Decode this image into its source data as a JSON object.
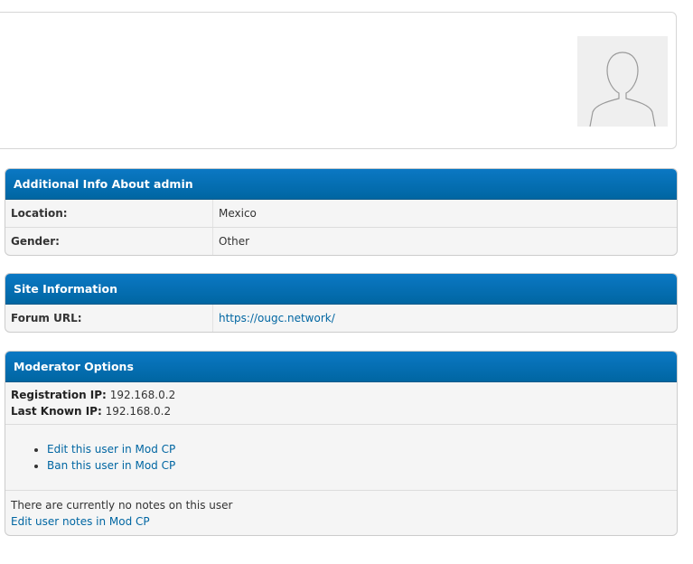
{
  "profile": {
    "avatar_icon": "default-avatar-icon"
  },
  "additional_info": {
    "title": "Additional Info About admin",
    "rows": [
      {
        "label": "Location:",
        "value": "Mexico"
      },
      {
        "label": "Gender:",
        "value": "Other"
      }
    ]
  },
  "site_information": {
    "title": "Site Information",
    "rows": [
      {
        "label": "Forum URL:",
        "value": "https://ougc.network/"
      }
    ]
  },
  "moderator_options": {
    "title": "Moderator Options",
    "registration_ip_label": "Registration IP:",
    "registration_ip": "192.168.0.2",
    "last_known_ip_label": "Last Known IP:",
    "last_known_ip": "192.168.0.2",
    "links": [
      "Edit this user in Mod CP",
      "Ban this user in Mod CP"
    ],
    "notes_text": "There are currently no notes on this user",
    "notes_link": "Edit user notes in Mod CP"
  },
  "colors": {
    "header_blue": "#0066a2",
    "link_blue": "#0066a2",
    "panel_bg": "#f5f5f5"
  }
}
